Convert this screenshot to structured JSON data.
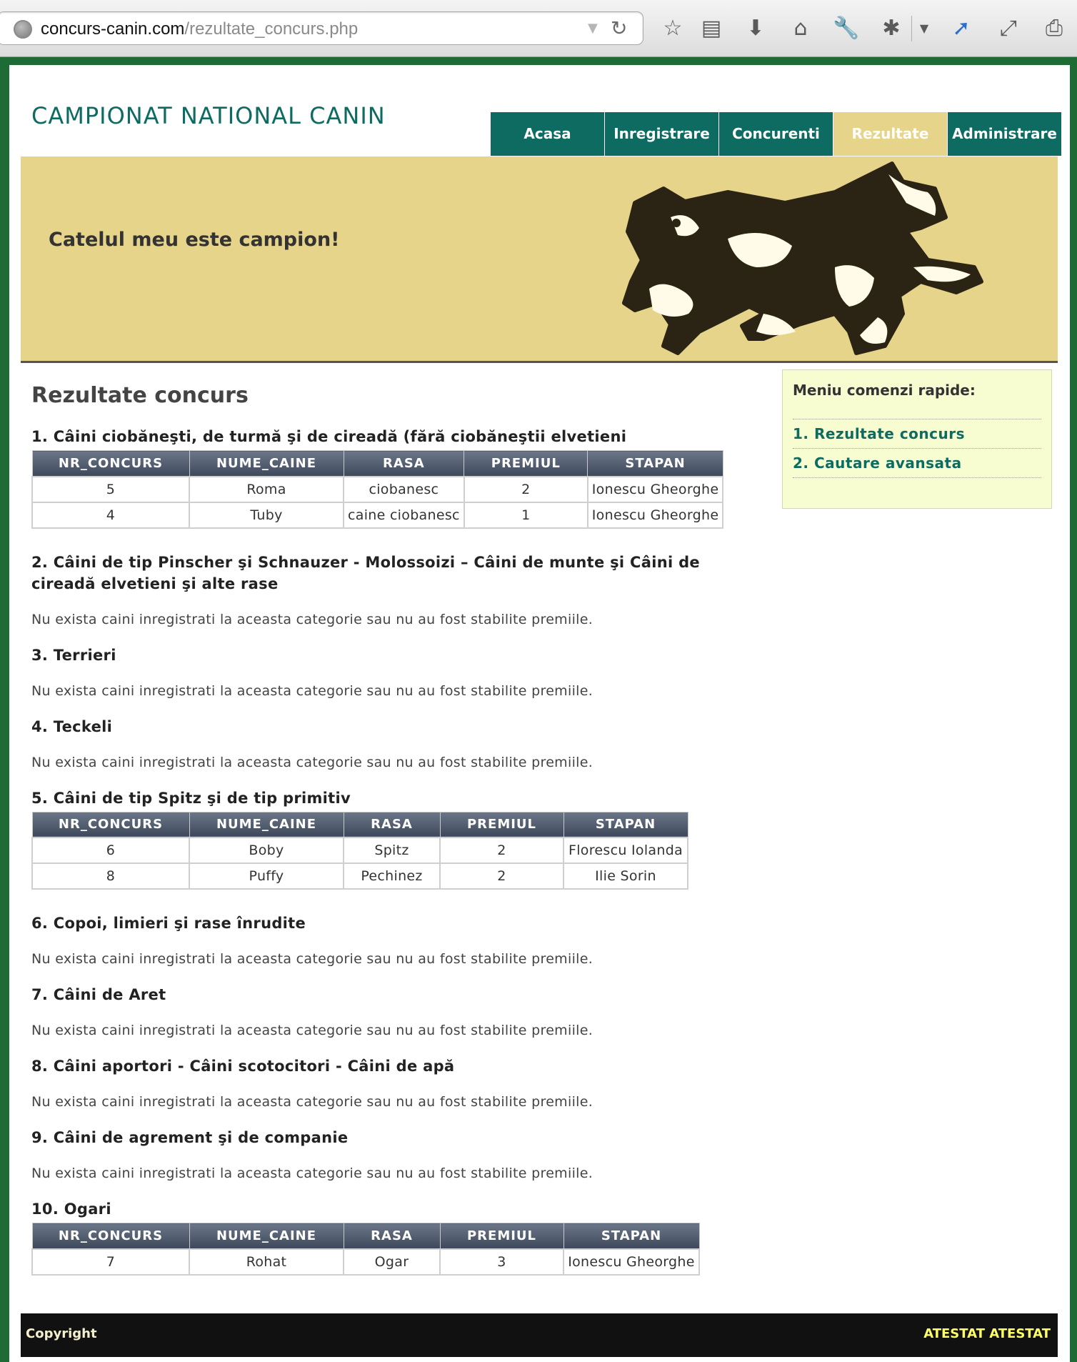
{
  "browser": {
    "url_host": "concurs-canin.com",
    "url_path": "/rezultate_concurs.php"
  },
  "site": {
    "title": "CAMPIONAT NATIONAL CANIN",
    "tagline": "Catelul meu este campion!"
  },
  "nav": {
    "items": [
      {
        "label": "Acasa",
        "active": false
      },
      {
        "label": "Inregistrare",
        "active": false
      },
      {
        "label": "Concurenti",
        "active": false
      },
      {
        "label": "Rezultate",
        "active": true
      },
      {
        "label": "Administrare",
        "active": false
      }
    ]
  },
  "content": {
    "heading": "Rezultate concurs",
    "table_headers": [
      "NR_CONCURS",
      "NUME_CAINE",
      "RASA",
      "PREMIUL",
      "STAPAN"
    ],
    "empty_message": "Nu exista caini inregistrati la aceasta categorie sau nu au fost stabilite premiile.",
    "categories": [
      {
        "title": "1. Câini ciobăneşti, de turmă şi de cireadă (fără ciobăneştii elvetieni",
        "rows": [
          [
            "5",
            "Roma",
            "ciobanesc",
            "2",
            "Ionescu Gheorghe"
          ],
          [
            "4",
            "Tuby",
            "caine ciobanesc",
            "1",
            "Ionescu Gheorghe"
          ]
        ]
      },
      {
        "title": "2. Câini de tip Pinscher şi Schnauzer - Molossoizi – Câini de munte şi Câini de cireadă elvetieni şi alte rase",
        "rows": []
      },
      {
        "title": "3. Terrieri",
        "rows": []
      },
      {
        "title": "4. Teckeli",
        "rows": []
      },
      {
        "title": "5. Câini de tip Spitz şi de tip primitiv",
        "rows": [
          [
            "6",
            "Boby",
            "Spitz",
            "2",
            "Florescu Iolanda"
          ],
          [
            "8",
            "Puffy",
            "Pechinez",
            "2",
            "Ilie Sorin"
          ]
        ]
      },
      {
        "title": "6. Copoi, limieri şi rase înrudite",
        "rows": []
      },
      {
        "title": "7. Câini de Aret",
        "rows": []
      },
      {
        "title": "8. Câini aportori - Câini scotocitori - Câini de apă",
        "rows": []
      },
      {
        "title": "9. Câini de agrement şi de companie",
        "rows": []
      },
      {
        "title": "10. Ogari",
        "rows": [
          [
            "7",
            "Rohat",
            "Ogar",
            "3",
            "Ionescu Gheorghe"
          ]
        ]
      }
    ]
  },
  "sidebar": {
    "title": "Meniu comenzi rapide:",
    "items": [
      "1. Rezultate concurs",
      "2. Cautare avansata"
    ]
  },
  "footer": {
    "left": "Copyright",
    "right": "ATESTAT ATESTAT"
  },
  "colors": {
    "nav_bg": "#0d6b62",
    "nav_active_bg": "#e6d48a",
    "banner_bg": "#e6d48a",
    "frame_green": "#1f6b36",
    "sidebar_bg": "#f8fcd1"
  },
  "icons": [
    "globe-icon",
    "reload-icon",
    "star-icon",
    "reading-list-icon",
    "download-icon",
    "home-icon",
    "wrench-icon",
    "bug-icon",
    "cursor-icon",
    "fullscreen-icon",
    "print-icon"
  ]
}
